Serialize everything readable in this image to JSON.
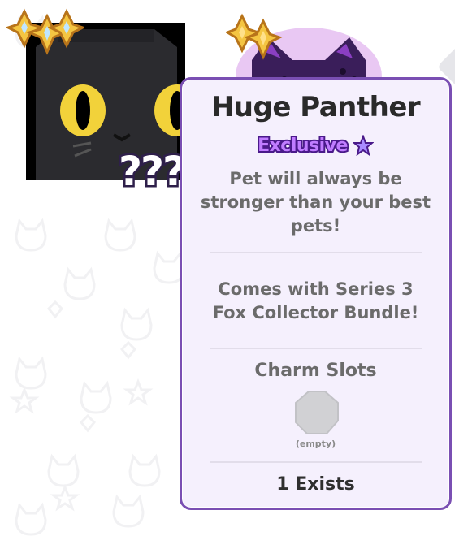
{
  "colors": {
    "tooltip_border": "#7a4fb3",
    "tooltip_bg": "#f5f0fd",
    "exclusive_fill": "#c07cff",
    "exclusive_outline": "#4a1a8a",
    "star": "#a98bff",
    "black_cat_eye": "#f2d23a"
  },
  "icons": {
    "tier_stars": "gold-diamond-stars-icon",
    "exclusive": "purple-star-icon",
    "charm_slot": "empty-octagon-slot-icon"
  },
  "left_pet": {
    "overlay_text": "???"
  },
  "tooltip": {
    "title": "Huge Panther",
    "rarity": "Exclusive",
    "description": "Pet will always be stronger than your best pets!",
    "bundle_note": "Comes with Series 3 Fox Collector Bundle!",
    "charm_slots_label": "Charm Slots",
    "charm_slot_state": "(empty)",
    "exists_count": "1 Exists"
  }
}
